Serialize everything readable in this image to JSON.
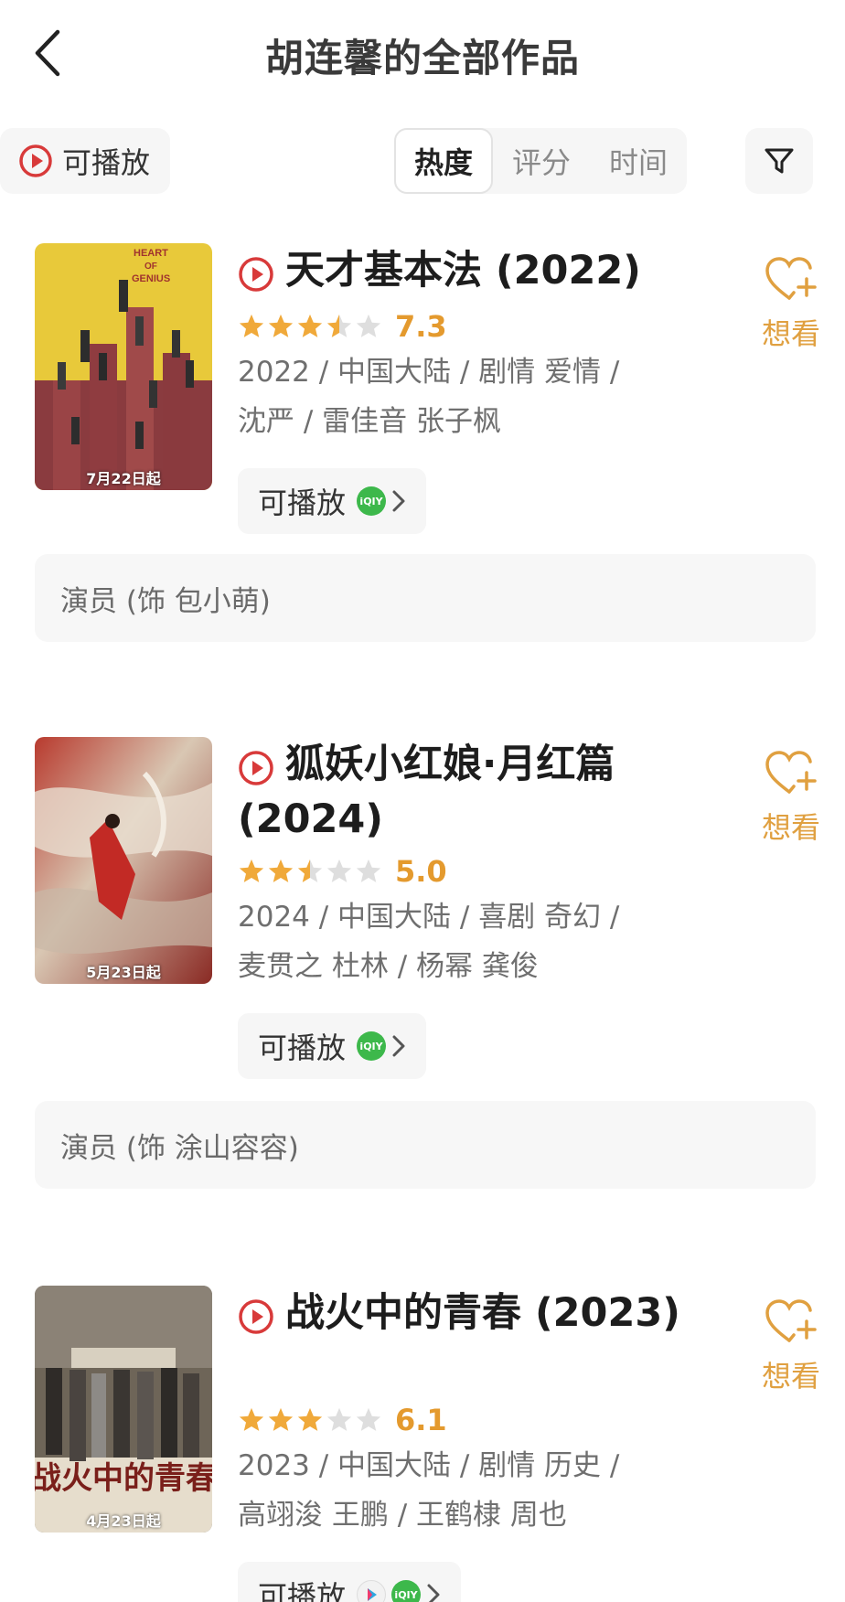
{
  "header": {
    "title": "胡连馨的全部作品"
  },
  "filters": {
    "playable_label": "可播放",
    "sort_tabs": [
      "热度",
      "评分",
      "时间"
    ],
    "active_sort": "热度"
  },
  "colors": {
    "accent": "#e0a040",
    "play_red": "#d83a3a",
    "star": "#f0a93a",
    "iqiyi_green": "#3db84b"
  },
  "movies": [
    {
      "title": "天才基本法 (2022)",
      "score": "7.3",
      "stars": 3.5,
      "meta_line1": "2022 / 中国大陆 / 剧情 爱情 /",
      "meta_line2": "沈严 / 雷佳音 张子枫",
      "play_label": "可播放",
      "platforms": [
        "iqiyi"
      ],
      "want_label": "想看",
      "role": "演员 (饰 包小萌)",
      "poster_date": "7月22日起",
      "poster_text": "HEART OF GENIUS"
    },
    {
      "title": "狐妖小红娘·月红篇 (2024)",
      "score": "5.0",
      "stars": 2.5,
      "meta_line1": "2024 / 中国大陆 / 喜剧 奇幻 /",
      "meta_line2": "麦贯之 杜林 / 杨幂 龚俊",
      "play_label": "可播放",
      "platforms": [
        "iqiyi"
      ],
      "want_label": "想看",
      "role": "演员 (饰 涂山容容)",
      "poster_date": "5月23日起"
    },
    {
      "title": "战火中的青春 (2023)",
      "score": "6.1",
      "stars": 3,
      "meta_line1": "2023 / 中国大陆 / 剧情 历史 /",
      "meta_line2": "高翊浚 王鹏 / 王鹤棣 周也",
      "play_label": "可播放",
      "platforms": [
        "youku",
        "iqiyi"
      ],
      "want_label": "想看",
      "poster_date": "4月23日起",
      "poster_text": "战火中的青春"
    }
  ]
}
